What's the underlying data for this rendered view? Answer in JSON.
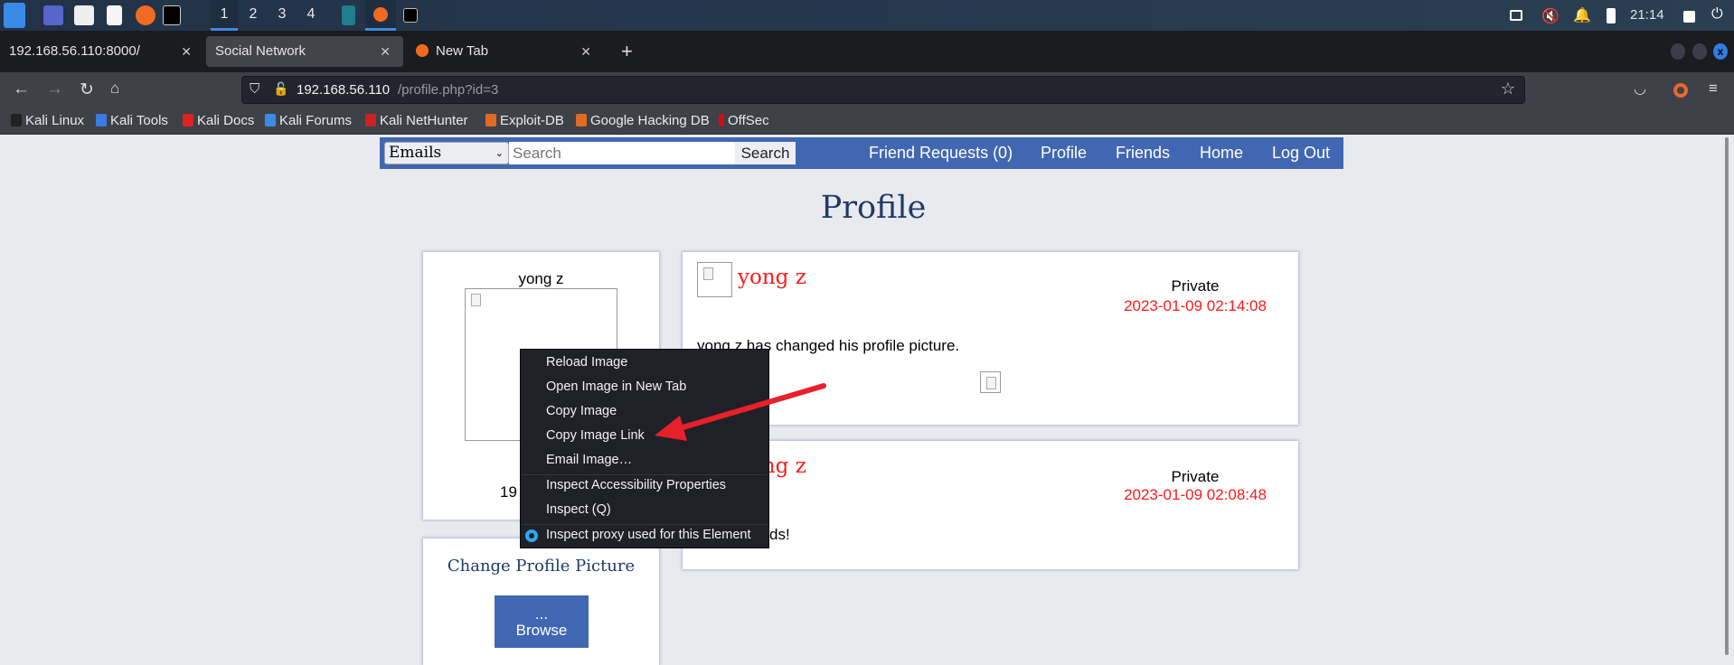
{
  "taskbar": {
    "workspaces": [
      "1",
      "2",
      "3",
      "4"
    ],
    "clock": "21:14",
    "icons": [
      "kali-menu-icon",
      "desktop-icon",
      "file-manager-icon",
      "text-editor-icon",
      "firefox-icon",
      "terminal-icon",
      "network-icon",
      "mute-icon",
      "bell-icon",
      "battery-icon",
      "lock-icon",
      "logout-icon"
    ]
  },
  "browser": {
    "tabs": [
      {
        "label": "192.168.56.110:8000/"
      },
      {
        "label": "Social Network"
      },
      {
        "label": "New Tab"
      }
    ],
    "url_host": "192.168.56.110",
    "url_path": "/profile.php?id=3",
    "bookmarks": [
      "Kali Linux",
      "Kali Tools",
      "Kali Docs",
      "Kali Forums",
      "Kali NetHunter",
      "Exploit-DB",
      "Google Hacking DB",
      "OffSec"
    ]
  },
  "site": {
    "select_value": "Emails",
    "search_placeholder": "Search",
    "search_button": "Search",
    "nav": [
      "Friend Requests (0)",
      "Profile",
      "Friends",
      "Home",
      "Log Out"
    ],
    "title": "Profile",
    "profile": {
      "name": "yong z",
      "dob_visible": "19"
    },
    "change_picture": {
      "title": "Change Profile Picture",
      "button_dots": "...",
      "button_label": "Browse"
    },
    "posts": [
      {
        "author": "yong z",
        "privacy": "Private",
        "date": "2023-01-09 02:14:08",
        "text": "yong z has changed his profile picture."
      },
      {
        "author": "yong z",
        "privacy": "Private",
        "date": "2023-01-09 02:08:48",
        "text_visible": "ds!"
      }
    ]
  },
  "context_menu": {
    "items": [
      "Reload Image",
      "Open Image in New Tab",
      "Copy Image",
      "Copy Image Link",
      "Email Image…",
      "Inspect Accessibility Properties",
      "Inspect (Q)",
      "Inspect proxy used for this Element"
    ]
  },
  "colors": {
    "site_blue": "#4267b2",
    "accent_red": "#ff1a1a",
    "arrow_red": "#e8202a"
  }
}
